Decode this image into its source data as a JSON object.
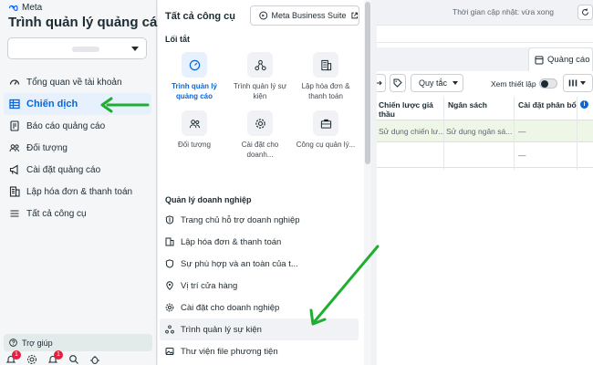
{
  "sidebar": {
    "brand": "Meta",
    "title": "Trình quản lý quảng cáo",
    "account_selected": "",
    "items": [
      {
        "label": "Tổng quan về tài khoản",
        "icon": "dashboard-icon"
      },
      {
        "label": "Chiến dịch",
        "icon": "table-icon",
        "active": true
      },
      {
        "label": "Báo cáo quảng cáo",
        "icon": "report-icon"
      },
      {
        "label": "Đối tượng",
        "icon": "audience-icon"
      },
      {
        "label": "Cài đặt quảng cáo",
        "icon": "megaphone-icon"
      },
      {
        "label": "Lập hóa đơn & thanh toán",
        "icon": "billing-icon"
      },
      {
        "label": "Tất cả công cụ",
        "icon": "menu-icon"
      }
    ],
    "help": "Trợ giúp",
    "notification_count_1": "1",
    "notification_count_2": "1"
  },
  "menu": {
    "title": "Tất cả công cụ",
    "business_suite_button": "Meta Business Suite",
    "shortcuts_title": "Lối tắt",
    "shortcuts": [
      {
        "label": "Trình quản lý quảng cáo",
        "icon": "gauge-icon",
        "active": true
      },
      {
        "label": "Trình quản lý sự kiện",
        "icon": "events-icon"
      },
      {
        "label": "Lập hóa đơn & thanh toán",
        "icon": "billing-icon"
      },
      {
        "label": "Đối tượng",
        "icon": "audience-icon"
      },
      {
        "label": "Cài đặt cho doanh...",
        "icon": "gear-icon"
      },
      {
        "label": "Công cụ quản lý...",
        "icon": "briefcase-icon"
      }
    ],
    "business_title": "Quản lý doanh nghiệp",
    "business_items": [
      {
        "label": "Trang chủ hỗ trợ doanh nghiệp",
        "icon": "shield-icon"
      },
      {
        "label": "Lập hóa đơn & thanh toán",
        "icon": "billing-icon"
      },
      {
        "label": "Sự phù hợp và an toàn của t...",
        "icon": "safety-icon"
      },
      {
        "label": "Vị trí cửa hàng",
        "icon": "location-icon"
      },
      {
        "label": "Cài đặt cho doanh nghiệp",
        "icon": "gear-icon"
      },
      {
        "label": "Trình quản lý sự kiện",
        "icon": "events-icon"
      },
      {
        "label": "Thư viện file phương tiện",
        "icon": "media-icon"
      }
    ]
  },
  "content": {
    "update_time": "Thời gian cập nhật: vừa xong",
    "ads_tab": "Quảng cáo",
    "rules_button": "Quy tắc",
    "preview_label": "Xem thiết lập",
    "columns": [
      "Chiến lược giá thầu",
      "Ngân sách",
      "Cài đặt phân bổ"
    ],
    "row1": [
      "Sử dụng chiến lư...",
      "Sử dụng ngân sá...",
      "—"
    ],
    "row2": [
      "",
      "",
      "—"
    ]
  },
  "colors": {
    "accent": "#0a66d8",
    "active_bg": "#e7f0fd",
    "arrow": "#1fae2f"
  }
}
